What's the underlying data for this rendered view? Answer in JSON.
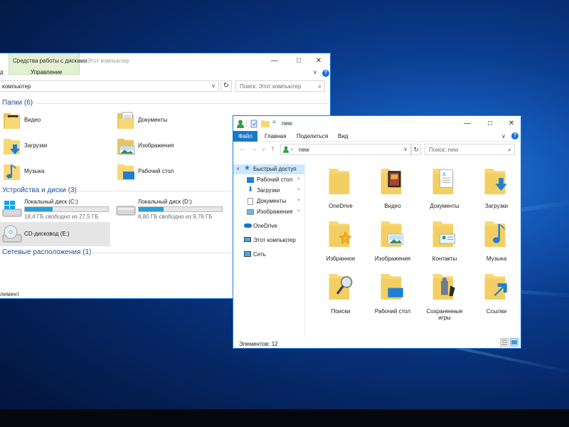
{
  "window1": {
    "title": "Этот компьютер",
    "ribbon_context": "Средства работы с дисками",
    "ribbon_subtab": "Управление",
    "tab_partial": "д",
    "address_partial": "компьютер",
    "search_placeholder": "Поиск: Этот компьютер",
    "folders_header": "Папки (6)",
    "folders": [
      {
        "label": "Видео",
        "icon": "video-folder-icon"
      },
      {
        "label": "Документы",
        "icon": "documents-folder-icon"
      },
      {
        "label": "Загрузки",
        "icon": "downloads-folder-icon"
      },
      {
        "label": "Изображения",
        "icon": "pictures-folder-icon"
      },
      {
        "label": "Музыка",
        "icon": "music-folder-icon"
      },
      {
        "label": "Рабочий стол",
        "icon": "desktop-folder-icon"
      }
    ],
    "drives_header": "Устройства и диски (3)",
    "drives": [
      {
        "name": "Локальный диск (C:)",
        "free": "18,4 ГБ свободно из 27,5 ГБ",
        "used_fraction": 0.33
      },
      {
        "name": "Локальный диск (D:)",
        "free": "6,80 ГБ свободно из 9,76 ГБ",
        "used_fraction": 0.3
      },
      {
        "name": "CD-дисковод (E:)"
      }
    ],
    "network_header": "Сетевые расположения (1)",
    "status_partial": "лемент"
  },
  "window2": {
    "title": "new",
    "tabs": {
      "file": "Файл",
      "home": "Главная",
      "share": "Поделиться",
      "view": "Вид"
    },
    "address": "new",
    "search_placeholder": "Поиск: new",
    "nav": {
      "quick_access": "Быстрый доступ",
      "desktop": "Рабочий стол",
      "downloads": "Загрузки",
      "documents": "Документы",
      "pictures": "Изображения",
      "onedrive": "OneDrive",
      "this_pc": "Этот компьютер",
      "network": "Сеть"
    },
    "items": [
      {
        "label": "OneDrive",
        "icon": "onedrive-folder-icon"
      },
      {
        "label": "Видео",
        "icon": "video-folder-icon"
      },
      {
        "label": "Документы",
        "icon": "documents-folder-icon"
      },
      {
        "label": "Загрузки",
        "icon": "downloads-folder-icon"
      },
      {
        "label": "Избранное",
        "icon": "favorites-folder-icon"
      },
      {
        "label": "Изображения",
        "icon": "pictures-folder-icon"
      },
      {
        "label": "Контакты",
        "icon": "contacts-folder-icon"
      },
      {
        "label": "Музыка",
        "icon": "music-folder-icon"
      },
      {
        "label": "Поиски",
        "icon": "searches-folder-icon"
      },
      {
        "label": "Рабочий стол",
        "icon": "desktop-folder-icon"
      },
      {
        "label": "Сохраненные игры",
        "icon": "saved-games-folder-icon"
      },
      {
        "label": "Ссылки",
        "icon": "links-folder-icon"
      }
    ],
    "status": "Элементов: 12"
  },
  "colors": {
    "accent": "#1979ca",
    "folder": "#f8d775",
    "header_blue": "#1e4e9a",
    "drive_fill": "#26a0da"
  }
}
